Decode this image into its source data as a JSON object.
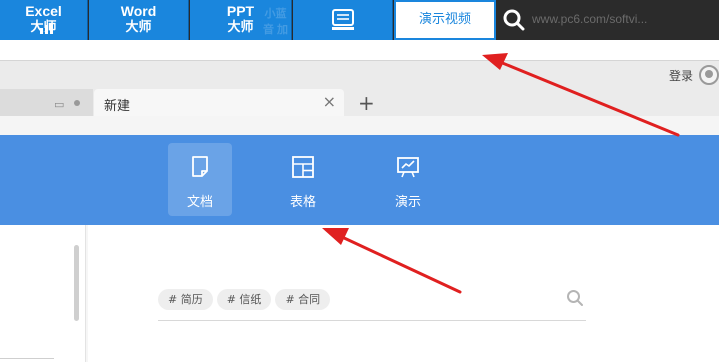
{
  "ribbon": {
    "tabs": [
      {
        "line1": "Excel",
        "line2": "大师"
      },
      {
        "line1": "Word",
        "line2": "大师"
      },
      {
        "line1": "PPT",
        "line2": "大师"
      }
    ],
    "video_tab": "演示视频",
    "ghost_text": "小蓝音  加",
    "url": "www.pc6.com/softvi..."
  },
  "browser": {
    "login_label": "登录",
    "active_tab_title": "新建",
    "close_glyph": "×",
    "new_tab_glyph": "+"
  },
  "app_bar": {
    "items": [
      {
        "label": "文档",
        "icon": "document-icon",
        "active": true
      },
      {
        "label": "表格",
        "icon": "table-icon",
        "active": false
      },
      {
        "label": "演示",
        "icon": "presentation-icon",
        "active": false
      }
    ]
  },
  "content": {
    "chips": [
      "# 简历",
      "# 信纸",
      "# 合同"
    ]
  },
  "colors": {
    "ribbon_blue": "#1a86dd",
    "app_bar_blue": "#4a8fe2",
    "arrow_red": "#e02020"
  }
}
